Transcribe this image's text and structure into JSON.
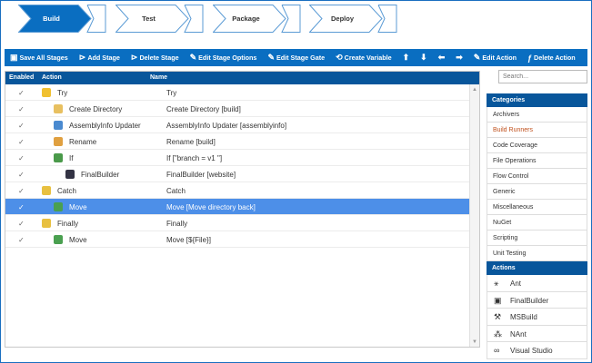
{
  "stages": [
    {
      "label": "Build",
      "active": true
    },
    {
      "label": "Test",
      "active": false
    },
    {
      "label": "Package",
      "active": false
    },
    {
      "label": "Deploy",
      "active": false
    }
  ],
  "toolbar": {
    "save_all": "Save All Stages",
    "add_stage": "Add Stage",
    "delete_stage": "Delete Stage",
    "edit_options": "Edit Stage Options",
    "edit_gate": "Edit Stage Gate",
    "create_variable": "Create Variable",
    "edit_action": "Edit Action",
    "delete_action": "Delete Action"
  },
  "grid": {
    "headers": {
      "enabled": "Enabled",
      "action": "Action",
      "name": "Name"
    },
    "rows": [
      {
        "action": "Try",
        "name": "Try",
        "indent": 0,
        "icon": "try-icon",
        "selected": false
      },
      {
        "action": "Create Directory",
        "name": "Create Directory [build]",
        "indent": 1,
        "icon": "folder-icon",
        "selected": false
      },
      {
        "action": "AssemblyInfo Updater",
        "name": "AssemblyInfo Updater [assemblyinfo]",
        "indent": 1,
        "icon": "assemblyinfo-icon",
        "selected": false
      },
      {
        "action": "Rename",
        "name": "Rename [build]",
        "indent": 1,
        "icon": "rename-icon",
        "selected": false
      },
      {
        "action": "If",
        "name": "If [\"branch = v1 \"]",
        "indent": 1,
        "icon": "if-icon",
        "selected": false
      },
      {
        "action": "FinalBuilder",
        "name": "FinalBuilder [website]",
        "indent": 2,
        "icon": "finalbuilder-icon",
        "selected": false
      },
      {
        "action": "Catch",
        "name": "Catch",
        "indent": 0,
        "icon": "catch-icon",
        "selected": false
      },
      {
        "action": "Move",
        "name": "Move [Move directory back]",
        "indent": 1,
        "icon": "move-icon",
        "selected": true
      },
      {
        "action": "Finally",
        "name": "Finally",
        "indent": 0,
        "icon": "finally-icon",
        "selected": false
      },
      {
        "action": "Move",
        "name": "Move [${File}]",
        "indent": 1,
        "icon": "move-icon",
        "selected": false
      }
    ]
  },
  "search": {
    "placeholder": "Search..."
  },
  "categories": {
    "title": "Categories",
    "items": [
      "Archivers",
      "Build Runners",
      "Code Coverage",
      "File Operations",
      "Flow Control",
      "Generic",
      "Miscellaneous",
      "NuGet",
      "Scripting",
      "Unit Testing"
    ],
    "highlighted": "Build Runners"
  },
  "actions": {
    "title": "Actions",
    "items": [
      "Ant",
      "FinalBuilder",
      "MSBuild",
      "NAnt",
      "Visual Studio"
    ]
  },
  "colors": {
    "accent": "#0a6ec1",
    "header": "#08569b",
    "selected": "#4d8fe8",
    "highlight": "#c0501c"
  }
}
